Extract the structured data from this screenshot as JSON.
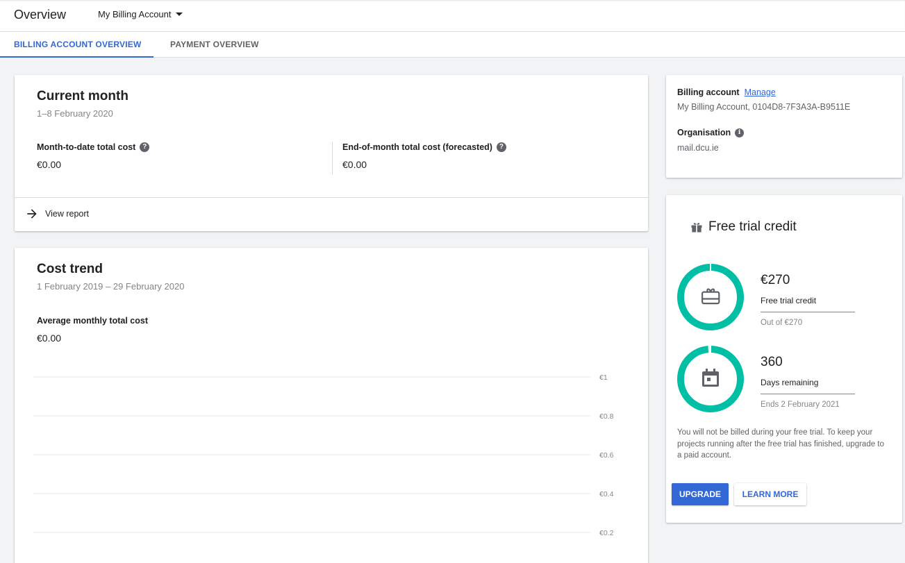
{
  "header": {
    "title": "Overview",
    "account_selector": "My Billing Account"
  },
  "tabs": [
    {
      "label": "BILLING ACCOUNT OVERVIEW",
      "active": true
    },
    {
      "label": "PAYMENT OVERVIEW",
      "active": false
    }
  ],
  "current_month": {
    "title": "Current month",
    "date_range": "1–8 February 2020",
    "mtd_label": "Month-to-date total cost",
    "mtd_value": "€0.00",
    "eom_label": "End-of-month total cost (forecasted)",
    "eom_value": "€0.00",
    "view_report": "View report"
  },
  "cost_trend": {
    "title": "Cost trend",
    "date_range": "1 February 2019 – 29 February 2020",
    "avg_label": "Average monthly total cost",
    "avg_value": "€0.00"
  },
  "chart_data": {
    "type": "line",
    "y_ticks": [
      "€1",
      "€0.8",
      "€0.6",
      "€0.4",
      "€0.2"
    ],
    "ylim": [
      0,
      1
    ],
    "grid": true,
    "series": []
  },
  "billing_account": {
    "label": "Billing account",
    "manage": "Manage",
    "value": "My Billing Account, 0104D8-7F3A3A-B9511E",
    "org_label": "Organisation",
    "org_value": "mail.dcu.ie"
  },
  "free_trial": {
    "title": "Free trial credit",
    "credit_amount": "€270",
    "credit_label": "Free trial credit",
    "credit_sub": "Out of €270",
    "credit_fraction": 1.0,
    "days_amount": "360",
    "days_label": "Days remaining",
    "days_sub": "Ends 2 February 2021",
    "days_fraction": 0.986,
    "note": "You will not be billed during your free trial. To keep your projects running after the free trial has finished, upgrade to a paid account.",
    "upgrade": "UPGRADE",
    "learn_more": "LEARN MORE"
  },
  "colors": {
    "accent": "#3367d6",
    "ring": "#00bfa5"
  }
}
